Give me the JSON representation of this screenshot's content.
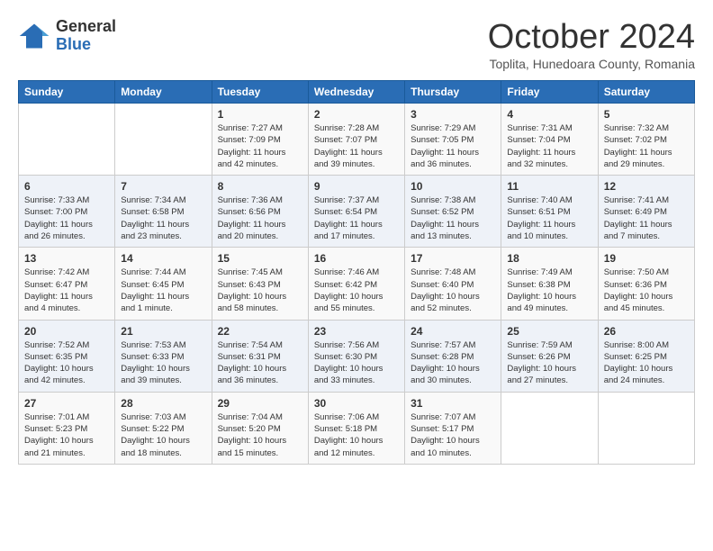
{
  "logo": {
    "general": "General",
    "blue": "Blue"
  },
  "title": "October 2024",
  "subtitle": "Toplita, Hunedoara County, Romania",
  "days_of_week": [
    "Sunday",
    "Monday",
    "Tuesday",
    "Wednesday",
    "Thursday",
    "Friday",
    "Saturday"
  ],
  "weeks": [
    [
      {
        "day": "",
        "sunrise": "",
        "sunset": "",
        "daylight": ""
      },
      {
        "day": "",
        "sunrise": "",
        "sunset": "",
        "daylight": ""
      },
      {
        "day": "1",
        "sunrise": "Sunrise: 7:27 AM",
        "sunset": "Sunset: 7:09 PM",
        "daylight": "Daylight: 11 hours and 42 minutes."
      },
      {
        "day": "2",
        "sunrise": "Sunrise: 7:28 AM",
        "sunset": "Sunset: 7:07 PM",
        "daylight": "Daylight: 11 hours and 39 minutes."
      },
      {
        "day": "3",
        "sunrise": "Sunrise: 7:29 AM",
        "sunset": "Sunset: 7:05 PM",
        "daylight": "Daylight: 11 hours and 36 minutes."
      },
      {
        "day": "4",
        "sunrise": "Sunrise: 7:31 AM",
        "sunset": "Sunset: 7:04 PM",
        "daylight": "Daylight: 11 hours and 32 minutes."
      },
      {
        "day": "5",
        "sunrise": "Sunrise: 7:32 AM",
        "sunset": "Sunset: 7:02 PM",
        "daylight": "Daylight: 11 hours and 29 minutes."
      }
    ],
    [
      {
        "day": "6",
        "sunrise": "Sunrise: 7:33 AM",
        "sunset": "Sunset: 7:00 PM",
        "daylight": "Daylight: 11 hours and 26 minutes."
      },
      {
        "day": "7",
        "sunrise": "Sunrise: 7:34 AM",
        "sunset": "Sunset: 6:58 PM",
        "daylight": "Daylight: 11 hours and 23 minutes."
      },
      {
        "day": "8",
        "sunrise": "Sunrise: 7:36 AM",
        "sunset": "Sunset: 6:56 PM",
        "daylight": "Daylight: 11 hours and 20 minutes."
      },
      {
        "day": "9",
        "sunrise": "Sunrise: 7:37 AM",
        "sunset": "Sunset: 6:54 PM",
        "daylight": "Daylight: 11 hours and 17 minutes."
      },
      {
        "day": "10",
        "sunrise": "Sunrise: 7:38 AM",
        "sunset": "Sunset: 6:52 PM",
        "daylight": "Daylight: 11 hours and 13 minutes."
      },
      {
        "day": "11",
        "sunrise": "Sunrise: 7:40 AM",
        "sunset": "Sunset: 6:51 PM",
        "daylight": "Daylight: 11 hours and 10 minutes."
      },
      {
        "day": "12",
        "sunrise": "Sunrise: 7:41 AM",
        "sunset": "Sunset: 6:49 PM",
        "daylight": "Daylight: 11 hours and 7 minutes."
      }
    ],
    [
      {
        "day": "13",
        "sunrise": "Sunrise: 7:42 AM",
        "sunset": "Sunset: 6:47 PM",
        "daylight": "Daylight: 11 hours and 4 minutes."
      },
      {
        "day": "14",
        "sunrise": "Sunrise: 7:44 AM",
        "sunset": "Sunset: 6:45 PM",
        "daylight": "Daylight: 11 hours and 1 minute."
      },
      {
        "day": "15",
        "sunrise": "Sunrise: 7:45 AM",
        "sunset": "Sunset: 6:43 PM",
        "daylight": "Daylight: 10 hours and 58 minutes."
      },
      {
        "day": "16",
        "sunrise": "Sunrise: 7:46 AM",
        "sunset": "Sunset: 6:42 PM",
        "daylight": "Daylight: 10 hours and 55 minutes."
      },
      {
        "day": "17",
        "sunrise": "Sunrise: 7:48 AM",
        "sunset": "Sunset: 6:40 PM",
        "daylight": "Daylight: 10 hours and 52 minutes."
      },
      {
        "day": "18",
        "sunrise": "Sunrise: 7:49 AM",
        "sunset": "Sunset: 6:38 PM",
        "daylight": "Daylight: 10 hours and 49 minutes."
      },
      {
        "day": "19",
        "sunrise": "Sunrise: 7:50 AM",
        "sunset": "Sunset: 6:36 PM",
        "daylight": "Daylight: 10 hours and 45 minutes."
      }
    ],
    [
      {
        "day": "20",
        "sunrise": "Sunrise: 7:52 AM",
        "sunset": "Sunset: 6:35 PM",
        "daylight": "Daylight: 10 hours and 42 minutes."
      },
      {
        "day": "21",
        "sunrise": "Sunrise: 7:53 AM",
        "sunset": "Sunset: 6:33 PM",
        "daylight": "Daylight: 10 hours and 39 minutes."
      },
      {
        "day": "22",
        "sunrise": "Sunrise: 7:54 AM",
        "sunset": "Sunset: 6:31 PM",
        "daylight": "Daylight: 10 hours and 36 minutes."
      },
      {
        "day": "23",
        "sunrise": "Sunrise: 7:56 AM",
        "sunset": "Sunset: 6:30 PM",
        "daylight": "Daylight: 10 hours and 33 minutes."
      },
      {
        "day": "24",
        "sunrise": "Sunrise: 7:57 AM",
        "sunset": "Sunset: 6:28 PM",
        "daylight": "Daylight: 10 hours and 30 minutes."
      },
      {
        "day": "25",
        "sunrise": "Sunrise: 7:59 AM",
        "sunset": "Sunset: 6:26 PM",
        "daylight": "Daylight: 10 hours and 27 minutes."
      },
      {
        "day": "26",
        "sunrise": "Sunrise: 8:00 AM",
        "sunset": "Sunset: 6:25 PM",
        "daylight": "Daylight: 10 hours and 24 minutes."
      }
    ],
    [
      {
        "day": "27",
        "sunrise": "Sunrise: 7:01 AM",
        "sunset": "Sunset: 5:23 PM",
        "daylight": "Daylight: 10 hours and 21 minutes."
      },
      {
        "day": "28",
        "sunrise": "Sunrise: 7:03 AM",
        "sunset": "Sunset: 5:22 PM",
        "daylight": "Daylight: 10 hours and 18 minutes."
      },
      {
        "day": "29",
        "sunrise": "Sunrise: 7:04 AM",
        "sunset": "Sunset: 5:20 PM",
        "daylight": "Daylight: 10 hours and 15 minutes."
      },
      {
        "day": "30",
        "sunrise": "Sunrise: 7:06 AM",
        "sunset": "Sunset: 5:18 PM",
        "daylight": "Daylight: 10 hours and 12 minutes."
      },
      {
        "day": "31",
        "sunrise": "Sunrise: 7:07 AM",
        "sunset": "Sunset: 5:17 PM",
        "daylight": "Daylight: 10 hours and 10 minutes."
      },
      {
        "day": "",
        "sunrise": "",
        "sunset": "",
        "daylight": ""
      },
      {
        "day": "",
        "sunrise": "",
        "sunset": "",
        "daylight": ""
      }
    ]
  ]
}
